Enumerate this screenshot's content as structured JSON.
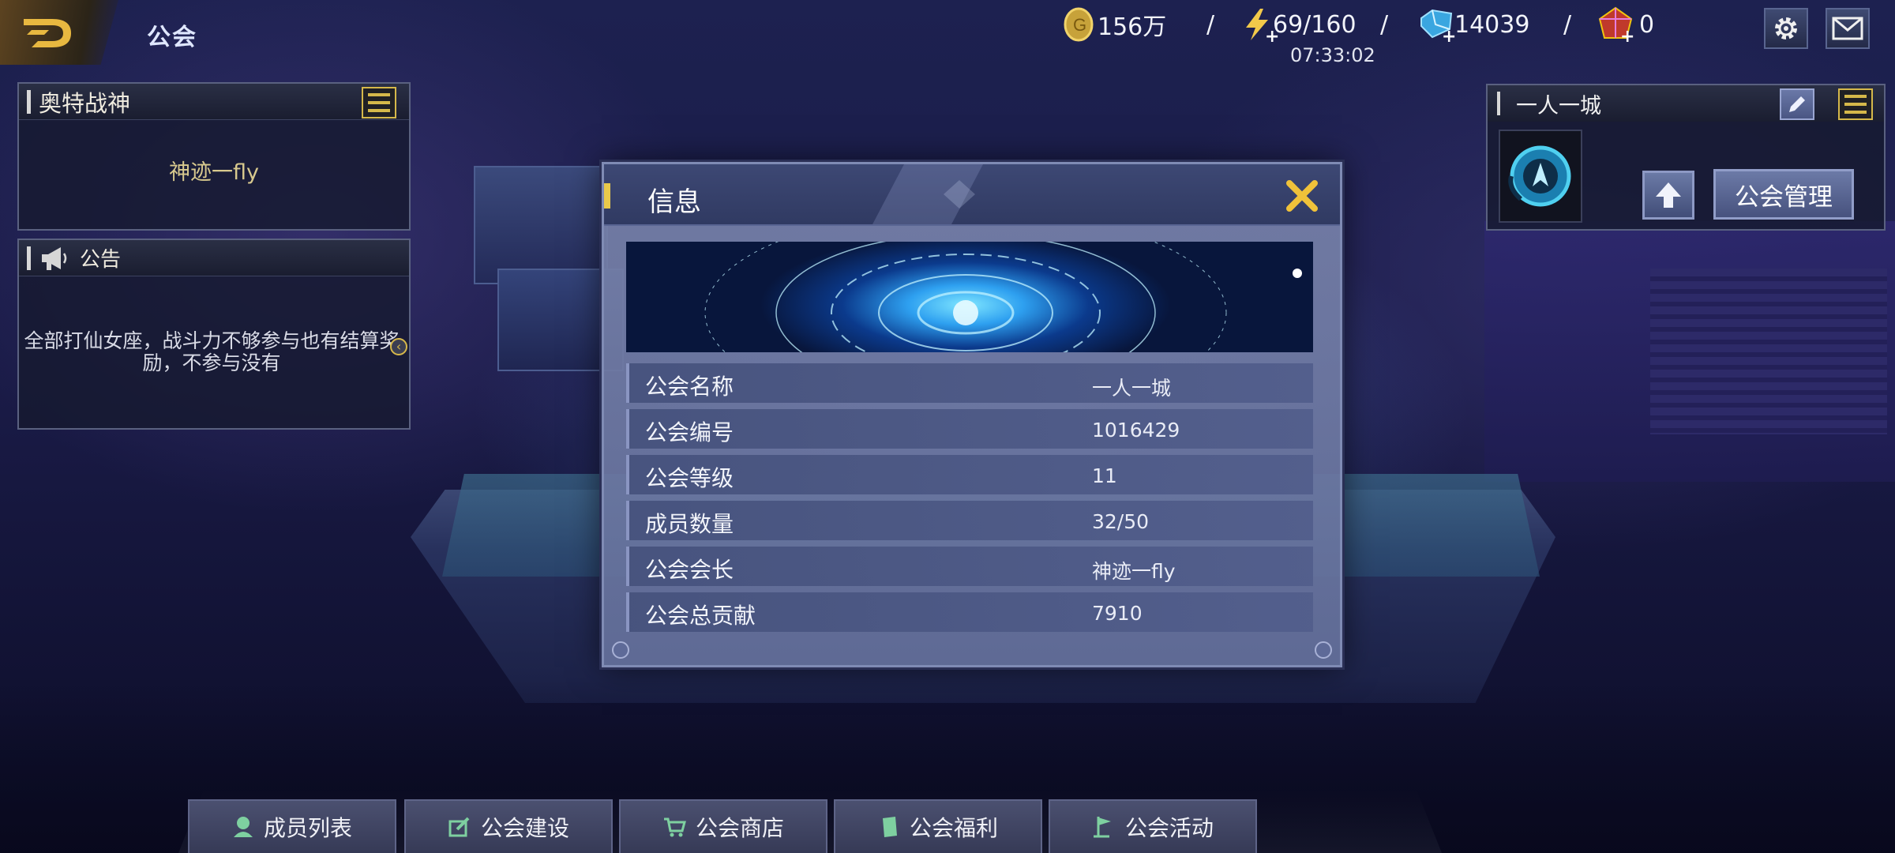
{
  "page": {
    "title": "公会"
  },
  "resources": {
    "gold": "156万",
    "energy": "69/160",
    "gems": "14039",
    "crystals": "0",
    "timer": "07:33:02"
  },
  "left_panel": {
    "title": "奥特战神",
    "leader": "神迹一fly"
  },
  "notice": {
    "title": "公告",
    "text": "全部打仙女座，战斗力不够参与也有结算奖励，不参与没有"
  },
  "dialog": {
    "title": "信息",
    "rows": [
      {
        "label": "公会名称",
        "value": "一人一城"
      },
      {
        "label": "公会编号",
        "value": "1016429"
      },
      {
        "label": "公会等级",
        "value": "11"
      },
      {
        "label": "成员数量",
        "value": "32/50"
      },
      {
        "label": "公会会长",
        "value": "神迹一fly"
      },
      {
        "label": "公会总贡献",
        "value": "7910"
      }
    ]
  },
  "guild_panel": {
    "name": "一人一城",
    "manage_label": "公会管理"
  },
  "tabs": [
    {
      "label": "成员列表",
      "icon": "member-icon"
    },
    {
      "label": "公会建设",
      "icon": "build-icon"
    },
    {
      "label": "公会商店",
      "icon": "cart-icon"
    },
    {
      "label": "公会福利",
      "icon": "gift-icon"
    },
    {
      "label": "公会活动",
      "icon": "flag-icon"
    }
  ],
  "colors": {
    "accent_gold": "#e9c94a",
    "dialog_bg": "#6e7aa8",
    "header_bg": "#303a62"
  }
}
